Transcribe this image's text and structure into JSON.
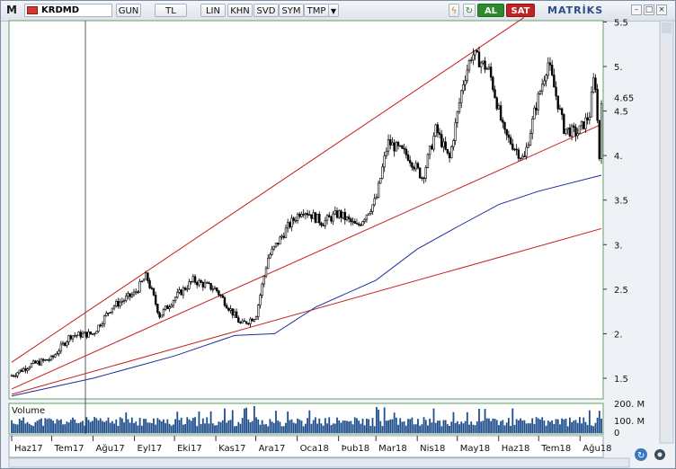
{
  "toolbar": {
    "logo": "M",
    "symbol": "KRDMD",
    "buttons": [
      "GUN",
      "TL",
      "LIN",
      "KHN",
      "SVD",
      "SYM",
      "TMP"
    ],
    "dropdown_icon": "triangle-down-icon",
    "icons": [
      "lightning-icon",
      "refresh-icon"
    ],
    "buy_label": "AL",
    "sell_label": "SAT",
    "brand": "MATRİKS",
    "window_buttons": [
      "minimize-icon",
      "restore-icon",
      "close-icon"
    ]
  },
  "colors": {
    "price": "#000000",
    "trend_channel": "#c81e1e",
    "moving_average": "#1c2e9a",
    "volume": "#1f4e8c",
    "grid_border": "#4caf50"
  },
  "chart_data": [
    {
      "type": "candlestick",
      "symbol": "KRDMD",
      "x": [
        "Haz17",
        "Tem17",
        "Ağu17",
        "Eyl17",
        "Eki17",
        "Kas17",
        "Ara17",
        "Oca18",
        "Þub18",
        "Mar18",
        "Nis18",
        "May18",
        "Haz18",
        "Tem18",
        "Ağu18"
      ],
      "y_ticks": [
        1.5,
        2,
        2.5,
        3,
        3.5,
        4,
        4.5,
        5,
        5.5
      ],
      "y_tick_labels": [
        "1.5",
        "2.",
        "2.5",
        "3.",
        "3.5",
        "4.",
        "4.5",
        "5.",
        "5.5"
      ],
      "ylim": [
        1.3,
        5.5
      ],
      "last_value": 4.65,
      "last_value_label": "4.65",
      "grid": false,
      "series": [
        {
          "close_path": [
            [
              "2017-06-01",
              1.53
            ],
            [
              "2017-06-15",
              1.65
            ],
            [
              "2017-07-01",
              1.72
            ],
            [
              "2017-07-15",
              1.98
            ],
            [
              "2017-08-01",
              2.0
            ],
            [
              "2017-08-15",
              2.3
            ],
            [
              "2017-09-01",
              2.45
            ],
            [
              "2017-09-10",
              2.65
            ],
            [
              "2017-09-20",
              2.2
            ],
            [
              "2017-10-01",
              2.4
            ],
            [
              "2017-10-15",
              2.6
            ],
            [
              "2017-11-01",
              2.5
            ],
            [
              "2017-11-20",
              2.1
            ],
            [
              "2017-12-01",
              2.2
            ],
            [
              "2017-12-10",
              2.85
            ],
            [
              "2017-12-25",
              3.2
            ],
            [
              "2018-01-05",
              3.4
            ],
            [
              "2018-01-20",
              3.25
            ],
            [
              "2018-02-01",
              3.35
            ],
            [
              "2018-02-15",
              3.2
            ],
            [
              "2018-03-01",
              3.5
            ],
            [
              "2018-03-10",
              4.15
            ],
            [
              "2018-03-25",
              4.0
            ],
            [
              "2018-04-05",
              3.75
            ],
            [
              "2018-04-15",
              4.3
            ],
            [
              "2018-04-25",
              3.95
            ],
            [
              "2018-05-05",
              4.8
            ],
            [
              "2018-05-12",
              5.15
            ],
            [
              "2018-05-25",
              4.95
            ],
            [
              "2018-06-05",
              4.25
            ],
            [
              "2018-06-20",
              3.95
            ],
            [
              "2018-06-28",
              4.5
            ],
            [
              "2018-07-08",
              5.05
            ],
            [
              "2018-07-20",
              4.3
            ],
            [
              "2018-07-30",
              4.25
            ],
            [
              "2018-08-08",
              4.45
            ],
            [
              "2018-08-12",
              4.95
            ],
            [
              "2018-08-16",
              3.85
            ],
            [
              "2018-08-17",
              4.65
            ]
          ]
        },
        {
          "name": "moving_average",
          "values": [
            [
              "2017-06-01",
              1.3
            ],
            [
              "2017-08-01",
              1.5
            ],
            [
              "2017-10-01",
              1.75
            ],
            [
              "2017-11-15",
              1.98
            ],
            [
              "2017-12-15",
              2.0
            ],
            [
              "2018-01-15",
              2.3
            ],
            [
              "2018-03-01",
              2.6
            ],
            [
              "2018-04-01",
              2.95
            ],
            [
              "2018-05-01",
              3.2
            ],
            [
              "2018-06-01",
              3.45
            ],
            [
              "2018-07-01",
              3.6
            ],
            [
              "2018-08-17",
              3.78
            ]
          ]
        }
      ],
      "trend_lines": [
        {
          "from": [
            "2017-06-01",
            1.68
          ],
          "to": [
            "2018-06-20",
            5.55
          ]
        },
        {
          "from": [
            "2017-06-01",
            1.38
          ],
          "to": [
            "2018-08-17",
            4.35
          ]
        },
        {
          "from": [
            "2017-06-01",
            1.32
          ],
          "to": [
            "2018-08-17",
            3.18
          ]
        }
      ]
    },
    {
      "type": "bar",
      "title": "Volume",
      "y_tick_labels": [
        "200. M",
        "100. M",
        "0"
      ],
      "ylim": [
        0,
        260
      ],
      "unit": "M"
    }
  ]
}
